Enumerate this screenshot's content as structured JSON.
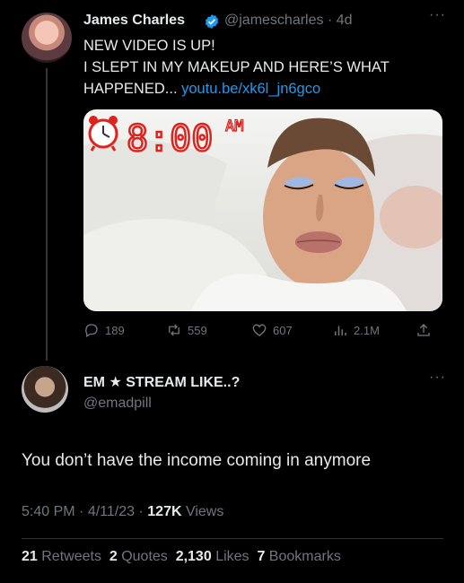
{
  "tweet": {
    "author_name": "James Charles",
    "handle": "@jamescharles",
    "time_sep": "·",
    "time": "4d",
    "text_line1": "NEW VIDEO IS UP!",
    "text_line2": "I SLEPT IN MY MAKEUP AND HERE’S WHAT",
    "text_line3_prefix": "HAPPENED...",
    "link": "youtu.be/xk6l_jn6gco",
    "media_clock_time": "8:00",
    "media_clock_ampm": "AM",
    "actions": {
      "replies": "189",
      "retweets": "559",
      "likes": "607",
      "views": "2.1M"
    }
  },
  "reply": {
    "author_name": "EM ★ STREAM LIKE..?",
    "handle": "@emadpill",
    "text": "You don’t have the income coming in anymore",
    "time": "5:40 PM",
    "date": "4/11/23",
    "views_count": "127K",
    "views_label": "Views",
    "sep": "·",
    "stats": {
      "retweets_count": "21",
      "retweets_label": "Retweets",
      "quotes_count": "2",
      "quotes_label": "Quotes",
      "likes_count": "2,130",
      "likes_label": "Likes",
      "bookmarks_count": "7",
      "bookmarks_label": "Bookmarks"
    }
  },
  "more_glyph": "···",
  "colors": {
    "background": "#000000",
    "text": "#e7e9ea",
    "muted": "#71767b",
    "link": "#1d9bf0",
    "verified": "#1d9bf0",
    "clock": "#e0221c"
  }
}
